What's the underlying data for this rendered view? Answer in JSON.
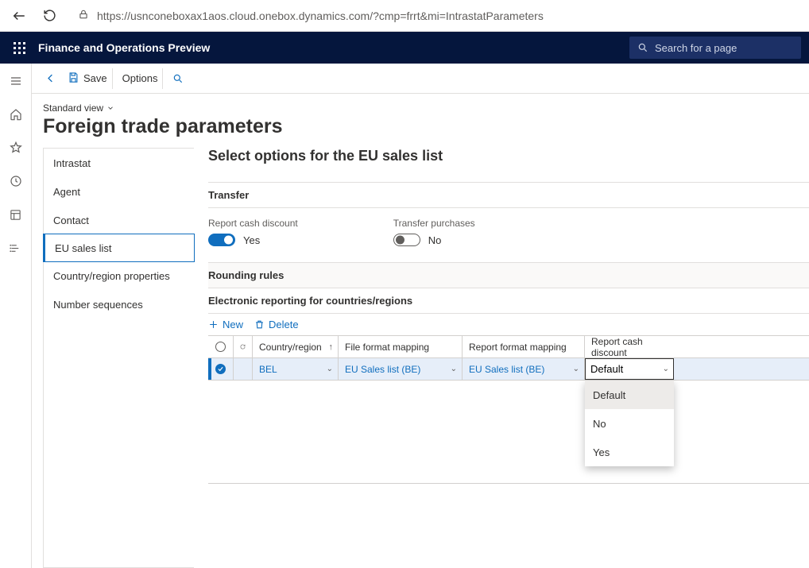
{
  "browser": {
    "url": "https://usnconeboxax1aos.cloud.onebox.dynamics.com/?cmp=frrt&mi=IntrastatParameters"
  },
  "appbar": {
    "title": "Finance and Operations Preview",
    "search_placeholder": "Search for a page"
  },
  "cmd": {
    "save": "Save",
    "options": "Options"
  },
  "header": {
    "view": "Standard view",
    "title": "Foreign trade parameters"
  },
  "left_tabs": [
    "Intrastat",
    "Agent",
    "Contact",
    "EU sales list",
    "Country/region properties",
    "Number sequences"
  ],
  "panel": {
    "title": "Select options for the EU sales list",
    "transfer": {
      "label": "Transfer",
      "cash_discount": {
        "label": "Report cash discount",
        "value": "Yes"
      },
      "transfer_purchases": {
        "label": "Transfer purchases",
        "value": "No"
      }
    },
    "rounding": {
      "label": "Rounding rules"
    },
    "er": {
      "label": "Electronic reporting for countries/regions",
      "tools": {
        "new": "New",
        "delete": "Delete"
      },
      "columns": {
        "country": "Country/region",
        "file": "File format mapping",
        "report": "Report format mapping",
        "discount": "Report cash discount"
      },
      "rows": [
        {
          "country": "BEL",
          "file": "EU Sales list (BE)",
          "report": "EU Sales list (BE)",
          "discount": "Default"
        }
      ],
      "dropdown": {
        "options": [
          "Default",
          "No",
          "Yes"
        ]
      }
    }
  }
}
